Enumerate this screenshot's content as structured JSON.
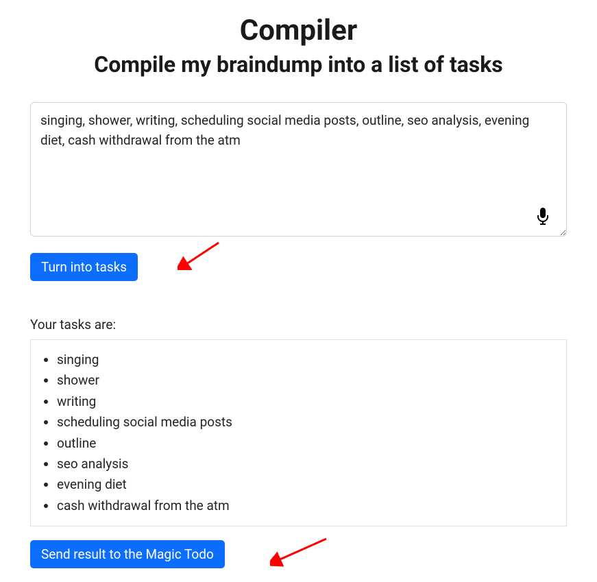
{
  "header": {
    "title": "Compiler",
    "subtitle": "Compile my braindump into a list of tasks"
  },
  "input": {
    "value": "singing, shower, writing, scheduling social media posts, outline, seo analysis, evening diet, cash withdrawal from the atm"
  },
  "buttons": {
    "compile": "Turn into tasks",
    "send": "Send result to the Magic Todo"
  },
  "results": {
    "label": "Your tasks are:",
    "tasks": [
      "singing",
      "shower",
      "writing",
      "scheduling social media posts",
      "outline",
      "seo analysis",
      "evening diet",
      "cash withdrawal from the atm"
    ]
  },
  "colors": {
    "primary_button": "#0d6efd",
    "arrow": "#ff0000"
  }
}
